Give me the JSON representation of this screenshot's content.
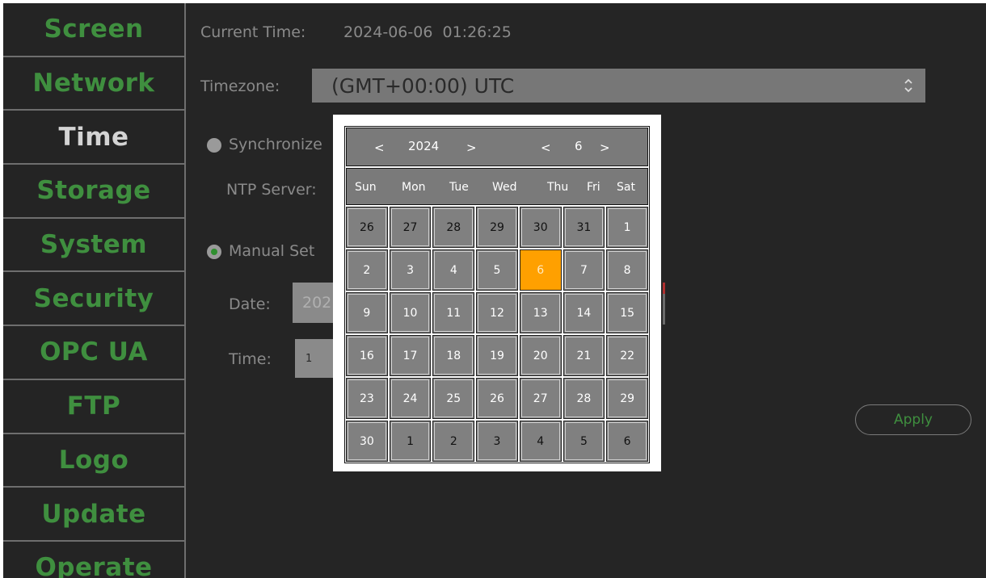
{
  "sidebar": {
    "items": [
      {
        "label": "Screen",
        "active": false
      },
      {
        "label": "Network",
        "active": false
      },
      {
        "label": "Time",
        "active": true
      },
      {
        "label": "Storage",
        "active": false
      },
      {
        "label": "System",
        "active": false
      },
      {
        "label": "Security",
        "active": false
      },
      {
        "label": "OPC UA",
        "active": false
      },
      {
        "label": "FTP",
        "active": false
      },
      {
        "label": "Logo",
        "active": false
      },
      {
        "label": "Update",
        "active": false
      },
      {
        "label": "Operate",
        "active": false
      }
    ]
  },
  "time_page": {
    "current_time_label": "Current Time:",
    "current_time_value": "2024-06-06  01:26:25",
    "timezone_label": "Timezone:",
    "timezone_value": "(GMT+00:00) UTC",
    "sync_option_label": "Synchronize",
    "ntp_server_label": "NTP Server:",
    "manual_option_label": "Manual Set",
    "date_label": "Date:",
    "date_value_partial": "202",
    "time_label": "Time:",
    "time_value_partial": "1",
    "apply_label": "Apply",
    "selected_mode": "manual"
  },
  "calendar": {
    "prev_year": "<",
    "year": "2024",
    "next_year": ">",
    "prev_month": "<",
    "month": "6",
    "next_month": ">",
    "weekdays": [
      "Sun",
      "Mon",
      "Tue",
      "Wed",
      "Thu",
      "Fri",
      "Sat"
    ],
    "days": [
      {
        "d": "26",
        "cur": false
      },
      {
        "d": "27",
        "cur": false
      },
      {
        "d": "28",
        "cur": false
      },
      {
        "d": "29",
        "cur": false
      },
      {
        "d": "30",
        "cur": false
      },
      {
        "d": "31",
        "cur": false
      },
      {
        "d": "1",
        "cur": true
      },
      {
        "d": "2",
        "cur": true
      },
      {
        "d": "3",
        "cur": true
      },
      {
        "d": "4",
        "cur": true
      },
      {
        "d": "5",
        "cur": true
      },
      {
        "d": "6",
        "cur": true,
        "selected": true
      },
      {
        "d": "7",
        "cur": true
      },
      {
        "d": "8",
        "cur": true
      },
      {
        "d": "9",
        "cur": true
      },
      {
        "d": "10",
        "cur": true
      },
      {
        "d": "11",
        "cur": true
      },
      {
        "d": "12",
        "cur": true
      },
      {
        "d": "13",
        "cur": true
      },
      {
        "d": "14",
        "cur": true
      },
      {
        "d": "15",
        "cur": true
      },
      {
        "d": "16",
        "cur": true
      },
      {
        "d": "17",
        "cur": true
      },
      {
        "d": "18",
        "cur": true
      },
      {
        "d": "19",
        "cur": true
      },
      {
        "d": "20",
        "cur": true
      },
      {
        "d": "21",
        "cur": true
      },
      {
        "d": "22",
        "cur": true
      },
      {
        "d": "23",
        "cur": true
      },
      {
        "d": "24",
        "cur": true
      },
      {
        "d": "25",
        "cur": true
      },
      {
        "d": "26",
        "cur": true
      },
      {
        "d": "27",
        "cur": true
      },
      {
        "d": "28",
        "cur": true
      },
      {
        "d": "29",
        "cur": true
      },
      {
        "d": "30",
        "cur": true
      },
      {
        "d": "1",
        "cur": false
      },
      {
        "d": "2",
        "cur": false
      },
      {
        "d": "3",
        "cur": false
      },
      {
        "d": "4",
        "cur": false
      },
      {
        "d": "5",
        "cur": false
      },
      {
        "d": "6",
        "cur": false
      }
    ]
  },
  "colors": {
    "background": "#252525",
    "sidebar_text": "#3f8f3f",
    "sidebar_active_text": "#d4d4d4",
    "selected_day": "#ffa000",
    "cell": "#808080"
  },
  "icons": {
    "timezone_select": "chevron-up-down-icon",
    "radio_off": "radio-unchecked-icon",
    "radio_on": "radio-checked-icon"
  }
}
